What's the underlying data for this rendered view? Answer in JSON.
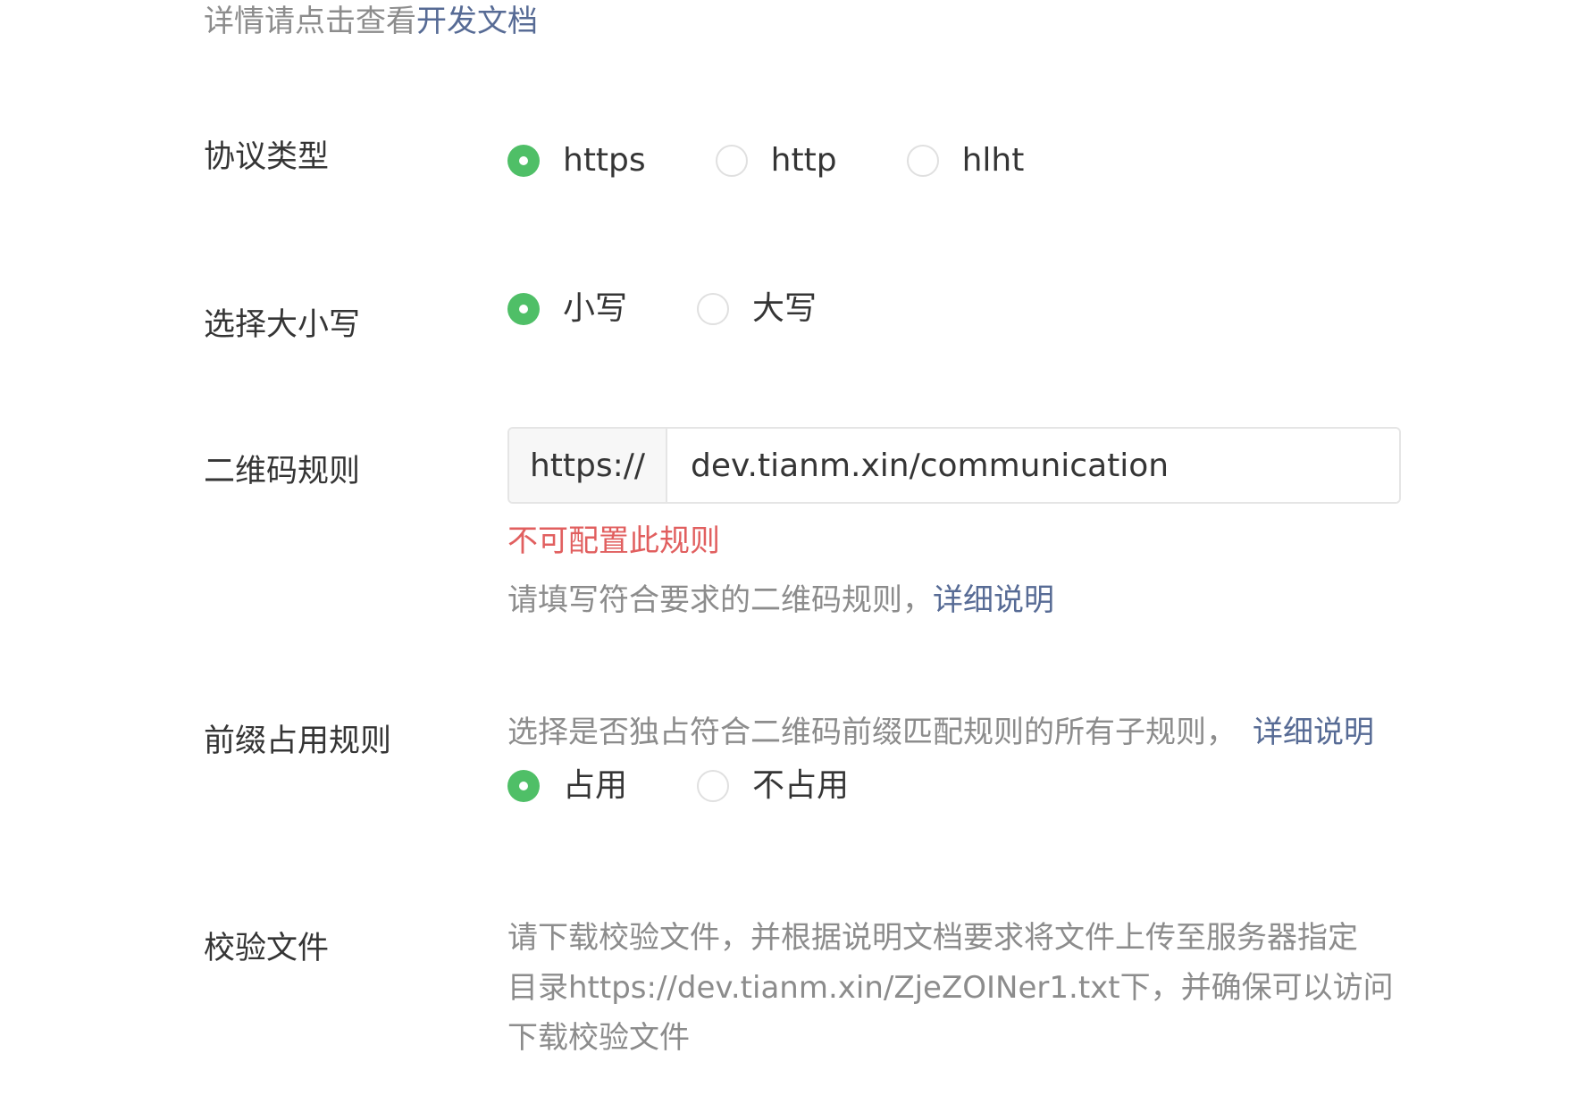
{
  "top_hint": {
    "text": "详情请点击查看",
    "link": "开发文档"
  },
  "protocol": {
    "label": "协议类型",
    "options": [
      "https",
      "http",
      "hlht"
    ],
    "selected": "https"
  },
  "case": {
    "label": "选择大小写",
    "options": [
      "小写",
      "大写"
    ],
    "selected": "小写"
  },
  "qr_rule": {
    "label": "二维码规则",
    "prefix": "https://",
    "value": "dev.tianm.xin/communication",
    "error": "不可配置此规则",
    "hint": "请填写符合要求的二维码规则，",
    "hint_link": "详细说明"
  },
  "prefix_rule": {
    "label": "前缀占用规则",
    "hint": "选择是否独占符合二维码前缀匹配规则的所有子规则，",
    "hint_link": "详细说明",
    "options": [
      "占用",
      "不占用"
    ],
    "selected": "占用"
  },
  "verify_file": {
    "label": "校验文件",
    "hint_line1": "请下载校验文件，并根据说明文档要求将文件上传至服务器指定",
    "hint_line2": "目录https://dev.tianm.xin/ZjeZOINer1.txt下，并确保可以访问",
    "download_link": "下载校验文件"
  }
}
